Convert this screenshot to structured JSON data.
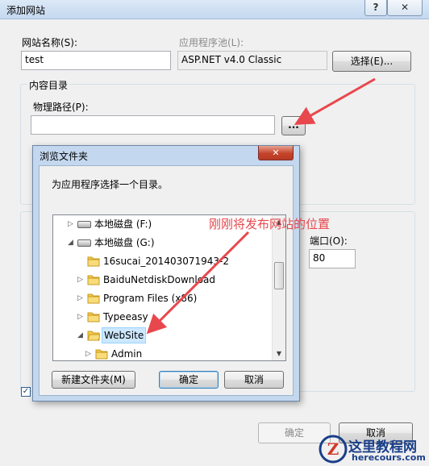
{
  "outer_dialog": {
    "title": "添加网站",
    "help_glyph": "?",
    "close_glyph": "✕",
    "site_name_label": "网站名称(S):",
    "site_name_value": "test",
    "app_pool_label": "应用程序池(L):",
    "app_pool_value": "ASP.NET v4.0 Classic",
    "select_button": "选择(E)...",
    "content_dir_label": "内容目录",
    "physical_path_label": "物理路径(P):",
    "physical_path_value": "",
    "browse_button": "...",
    "port_label": "端口(O):",
    "port_value": "80",
    "ok_button": "确定",
    "cancel_button": "取消"
  },
  "browse_dialog": {
    "title": "浏览文件夹",
    "close_glyph": "✕",
    "prompt": "为应用程序选择一个目录。",
    "tree": [
      {
        "label": "本地磁盘 (F:)",
        "type": "drive",
        "expanded": false
      },
      {
        "label": "本地磁盘 (G:)",
        "type": "drive",
        "expanded": true
      },
      {
        "label": "16sucai_20140307194​3-2",
        "type": "folder",
        "expanded": false
      },
      {
        "label": "BaiduNetdiskDownload",
        "type": "folder",
        "expanded": false
      },
      {
        "label": "Program Files (x86)",
        "type": "folder",
        "expanded": false
      },
      {
        "label": "Typeeasy",
        "type": "folder",
        "expanded": false
      },
      {
        "label": "WebSite",
        "type": "folder",
        "expanded": true,
        "selected": true
      },
      {
        "label": "Admin",
        "type": "folder",
        "expanded": false
      }
    ],
    "new_folder_button": "新建文件夹(M)",
    "ok_button": "确定",
    "cancel_button": "取消"
  },
  "annotation": {
    "text": "刚刚将发布网站的位置",
    "color": "#e8474d"
  },
  "watermark": {
    "title": "这里教程网",
    "url": "herecours.com",
    "color": "#1a3f8a"
  }
}
